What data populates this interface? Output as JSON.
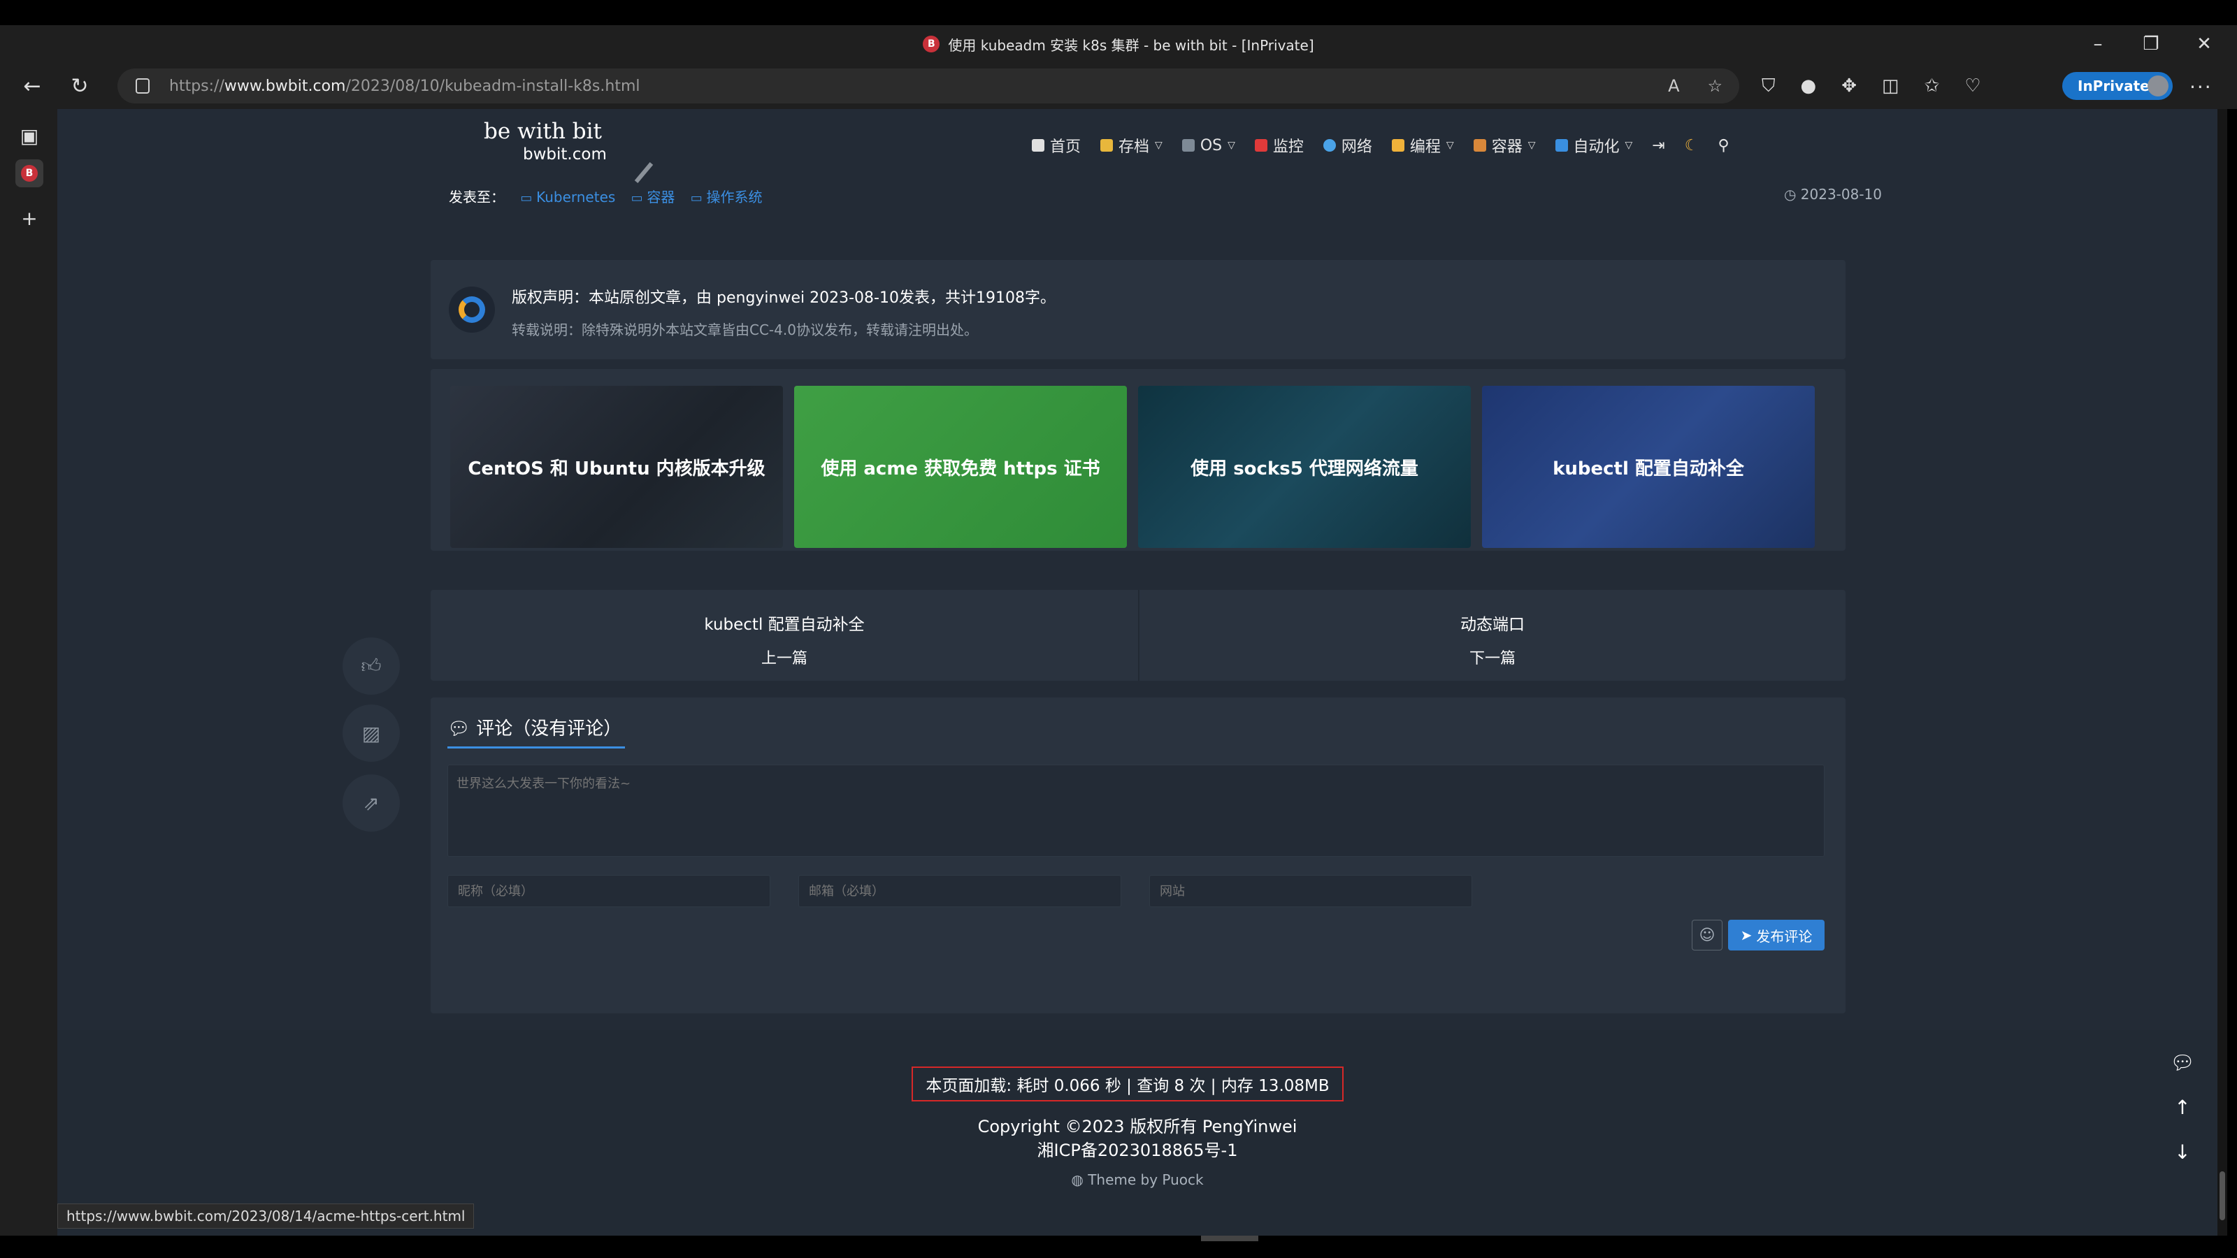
{
  "window": {
    "title": "使用 kubeadm 安装 k8s 集群 - be with bit - [InPrivate]",
    "favicon_letter": "B",
    "favicon_color": "#c9313a"
  },
  "browser": {
    "url_prefix": "https://",
    "url_host": "www.bwbit.com",
    "url_path": "/2023/08/10/kubeadm-install-k8s.html",
    "inprivate_label": "InPrivate"
  },
  "site": {
    "name": "be with bit",
    "domain": "bwbit.com",
    "nav": [
      {
        "label": "首页",
        "icon": "home-icon",
        "color": "#e0e0e0",
        "dropdown": false
      },
      {
        "label": "存档",
        "icon": "folder-icon",
        "color": "#e8b73c",
        "dropdown": true
      },
      {
        "label": "OS",
        "icon": "monitor-icon",
        "color": "#7e8a96",
        "dropdown": true
      },
      {
        "label": "监控",
        "icon": "alarm-icon",
        "color": "#e03a3a",
        "dropdown": false
      },
      {
        "label": "网络",
        "icon": "globe-icon",
        "color": "#4aa3e8",
        "dropdown": false
      },
      {
        "label": "编程",
        "icon": "person-icon",
        "color": "#f0b23a",
        "dropdown": true
      },
      {
        "label": "容器",
        "icon": "box-icon",
        "color": "#d9883a",
        "dropdown": true
      },
      {
        "label": "自动化",
        "icon": "cloud-icon",
        "color": "#3a8fe0",
        "dropdown": true
      }
    ]
  },
  "post": {
    "posted_to_label": "发表至：",
    "categories": [
      "Kubernetes",
      "容器",
      "操作系统"
    ],
    "date": "2023-08-10"
  },
  "copyright": {
    "line1": "版权声明：本站原创文章，由 pengyinwei 2023-08-10发表，共计19108字。",
    "line2": "转载说明：除特殊说明外本站文章皆由CC-4.0协议发布，转载请注明出处。"
  },
  "related": [
    {
      "title": "CentOS 和 Ubuntu 内核版本升级"
    },
    {
      "title": "使用 acme 获取免费 https 证书"
    },
    {
      "title": "使用 socks5 代理网络流量"
    },
    {
      "title": "kubectl 配置自动补全"
    }
  ],
  "post_nav": {
    "prev_title": "kubectl 配置自动补全",
    "prev_label": "上一篇",
    "next_title": "动态端口",
    "next_label": "下一篇"
  },
  "comments": {
    "title": "评论（没有评论）",
    "textarea_placeholder": "世界这么大发表一下你的看法~",
    "name_placeholder": "昵称（必填）",
    "email_placeholder": "邮箱（必填）",
    "website_placeholder": "网站",
    "submit_label": "发布评论"
  },
  "footer": {
    "stats": "本页面加载: 耗时 0.066 秒 | 查询 8 次 | 内存 13.08MB",
    "copyright": "Copyright ©2023 版权所有 PengYinwei",
    "icp": "湘ICP备2023018865号-1",
    "theme": "Theme by Puock"
  },
  "status_url": "https://www.bwbit.com/2023/08/14/acme-https-cert.html"
}
